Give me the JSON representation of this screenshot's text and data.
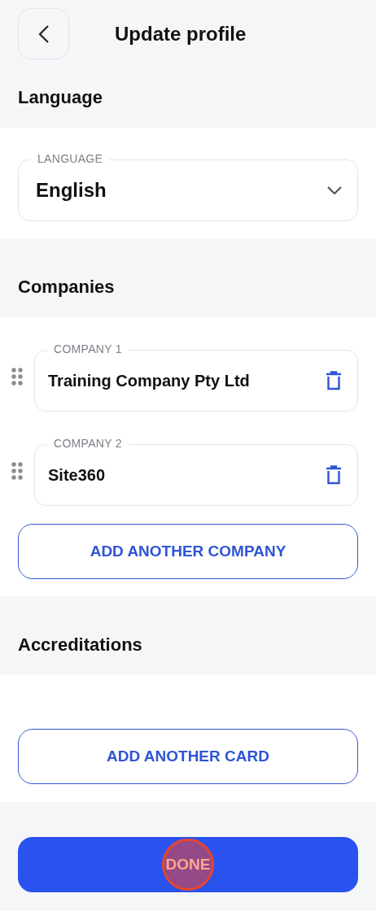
{
  "header": {
    "back_icon": true,
    "title": "Update profile"
  },
  "language": {
    "title": "Language",
    "field": {
      "label": "LANGUAGE",
      "value": "English"
    }
  },
  "companies": {
    "title": "Companies",
    "items": [
      {
        "label": "COMPANY 1",
        "value": "Training Company Pty Ltd"
      },
      {
        "label": "COMPANY 2",
        "value": "Site360"
      }
    ],
    "add_button": "ADD ANOTHER COMPANY"
  },
  "accreditations": {
    "title": "Accreditations",
    "add_button": "ADD ANOTHER CARD"
  },
  "done_button": {
    "label": "DONE",
    "touch_indicator": true
  }
}
